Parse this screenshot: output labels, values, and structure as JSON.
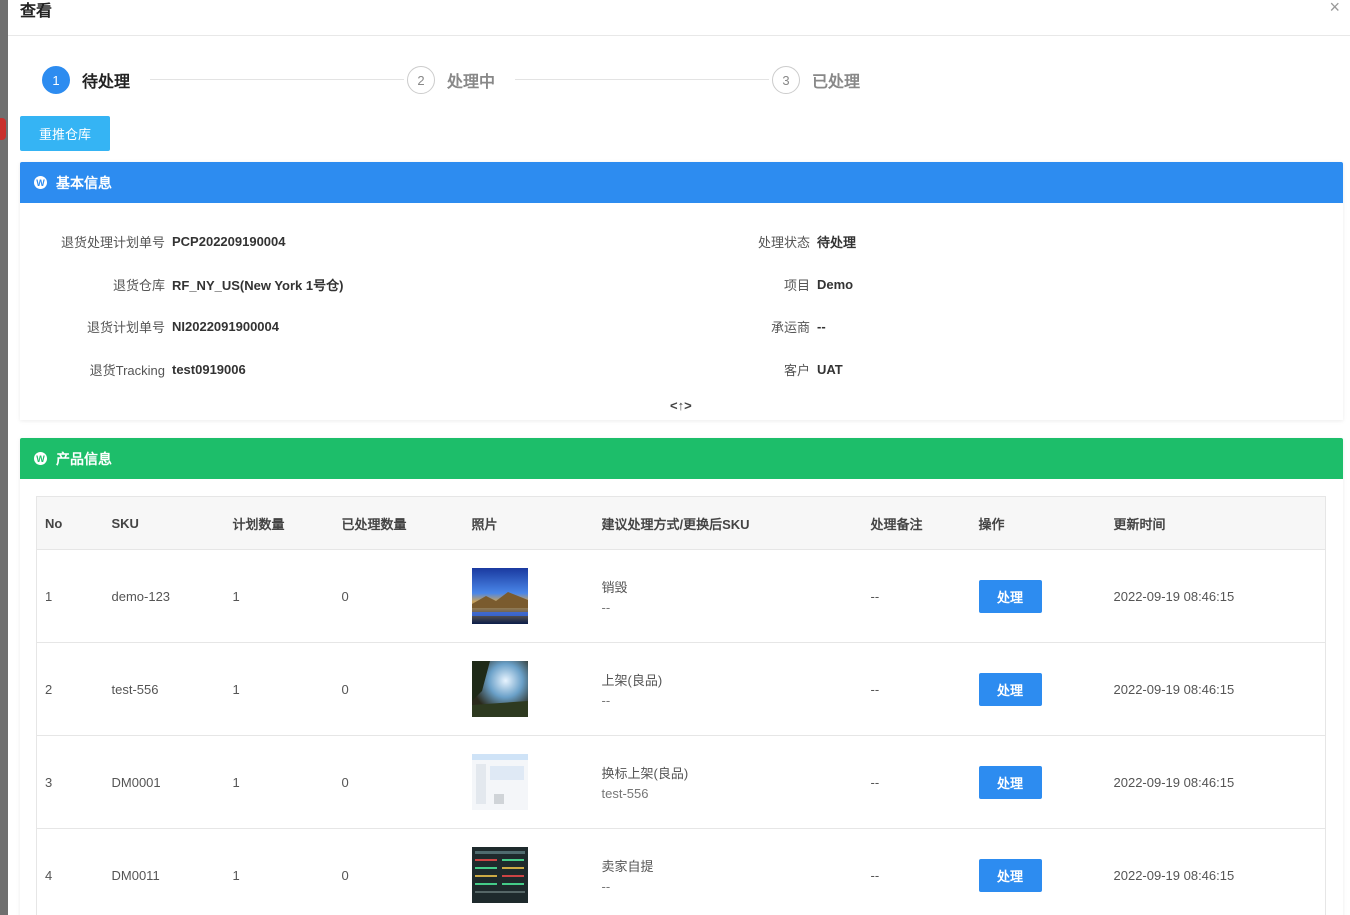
{
  "dialog": {
    "title": "查看",
    "close_symbol": "×"
  },
  "steps": [
    {
      "number": "1",
      "label": "待处理",
      "active": true
    },
    {
      "number": "2",
      "label": "处理中",
      "active": false
    },
    {
      "number": "3",
      "label": "已处理",
      "active": false
    }
  ],
  "actions": {
    "push_warehouse_label": "重推仓库"
  },
  "basic_info": {
    "title": "基本信息",
    "color": "#2d8cf0",
    "left": [
      {
        "label": "退货处理计划单号",
        "value": "PCP202209190004"
      },
      {
        "label": "退货仓库",
        "value": "RF_NY_US(New York 1号仓)"
      },
      {
        "label": "退货计划单号",
        "value": "NI2022091900004"
      },
      {
        "label": "退货Tracking",
        "value": "test0919006"
      }
    ],
    "right": [
      {
        "label": "处理状态",
        "value": "待处理"
      },
      {
        "label": "项目",
        "value": "Demo"
      },
      {
        "label": "承运商",
        "value": "--"
      },
      {
        "label": "客户",
        "value": "UAT"
      }
    ],
    "toggle_symbol": "<↑>"
  },
  "product_info": {
    "title": "产品信息",
    "color": "#1dbe6a",
    "columns": [
      "No",
      "SKU",
      "计划数量",
      "已处理数量",
      "照片",
      "建议处理方式/更换后SKU",
      "处理备注",
      "操作",
      "更新时间"
    ],
    "rows": [
      {
        "no": "1",
        "sku": "demo-123",
        "planned": "1",
        "processed": "0",
        "photo": "landscape-night-photo",
        "suggest": "销毁",
        "new_sku": "--",
        "remark": "--",
        "action": "处理",
        "updated": "2022-09-19 08:46:15"
      },
      {
        "no": "2",
        "sku": "test-556",
        "planned": "1",
        "processed": "0",
        "photo": "forest-sky-photo",
        "suggest": "上架(良品)",
        "new_sku": "--",
        "remark": "--",
        "action": "处理",
        "updated": "2022-09-19 08:46:15"
      },
      {
        "no": "3",
        "sku": "DM0001",
        "planned": "1",
        "processed": "0",
        "photo": "screenshot-photo",
        "suggest": "换标上架(良品)",
        "new_sku": "test-556",
        "remark": "--",
        "action": "处理",
        "updated": "2022-09-19 08:46:15"
      },
      {
        "no": "4",
        "sku": "DM0011",
        "planned": "1",
        "processed": "0",
        "photo": "dark-dashboard-photo",
        "suggest": "卖家自提",
        "new_sku": "--",
        "remark": "--",
        "action": "处理",
        "updated": "2022-09-19 08:46:15"
      }
    ]
  }
}
